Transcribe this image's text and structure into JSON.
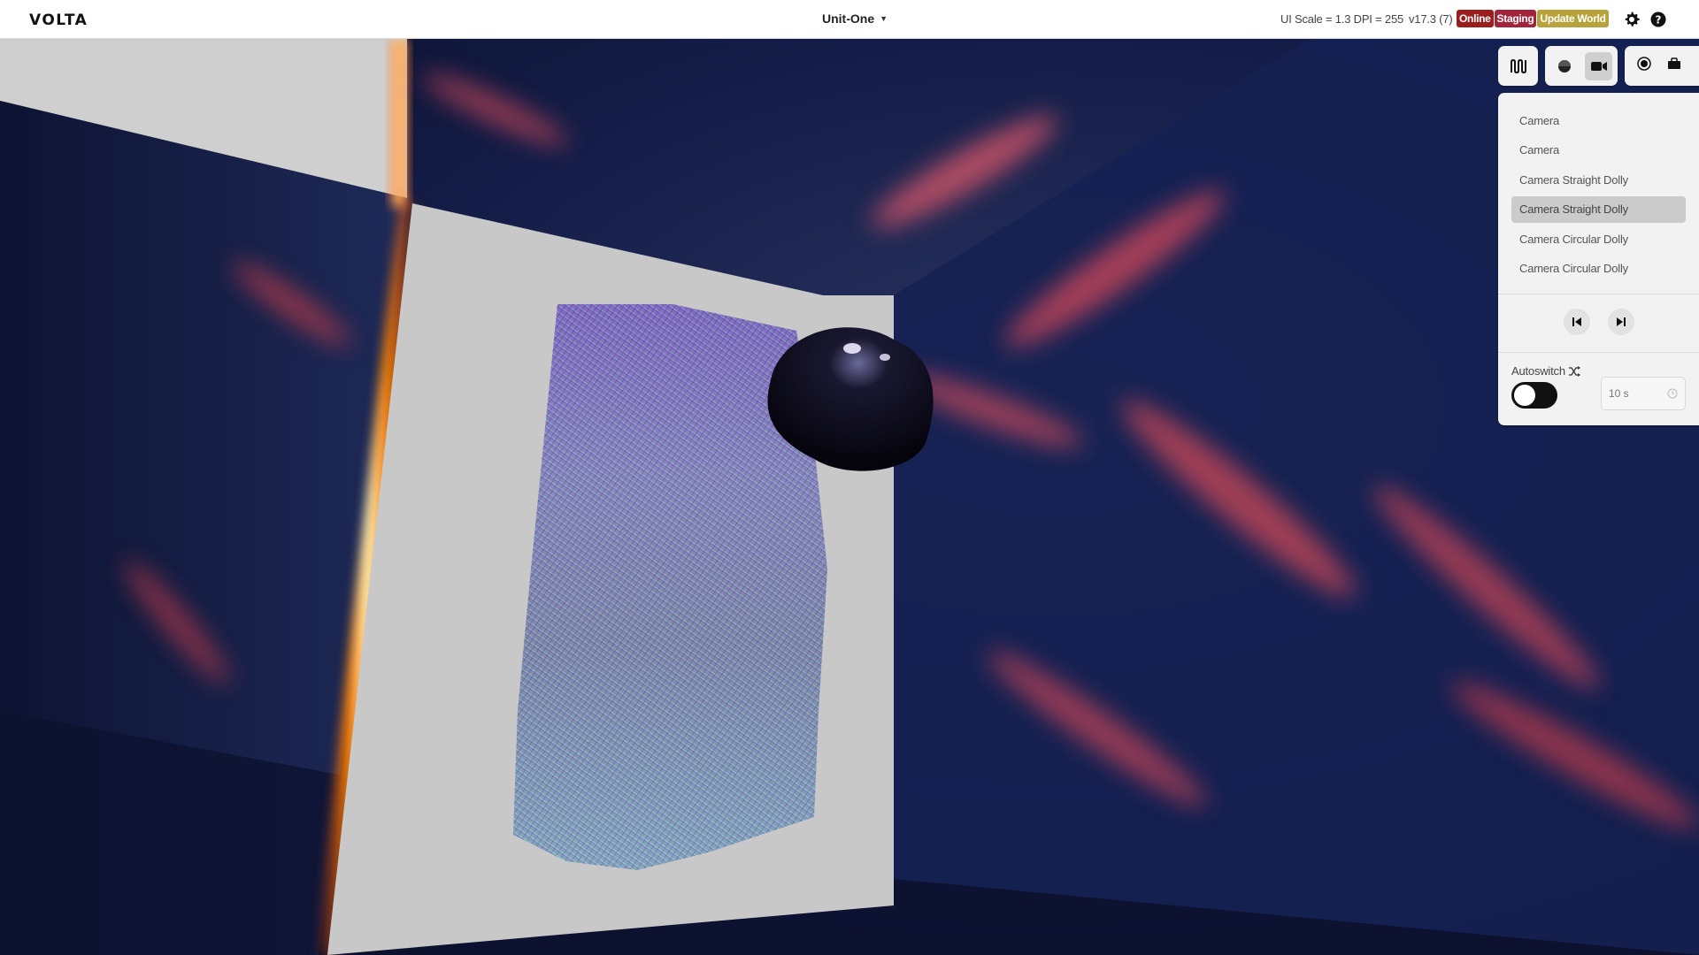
{
  "app": {
    "logo": "VOLTA",
    "project_name": "Unit-One",
    "ui_scale": "UI Scale = 1.3  DPI = 255",
    "version": "v17.3 (7)",
    "badges": {
      "online": "Online",
      "staging": "Staging",
      "update": "Update World"
    }
  },
  "colors": {
    "online_badge": "#9b1d1d",
    "staging_badge": "#a3233a",
    "update_badge": "#b8a23a",
    "panel_bg": "#f2f2f2",
    "selected_item": "#cbcbcb"
  },
  "toolbar": {
    "icons": [
      "sequencer-icon",
      "sphere-icon",
      "video-camera-icon",
      "record-icon",
      "briefcase-icon"
    ],
    "active": "video-camera-icon"
  },
  "camera_panel": {
    "items": [
      {
        "label": "Camera",
        "selected": false
      },
      {
        "label": "Camera",
        "selected": false
      },
      {
        "label": "Camera Straight Dolly",
        "selected": false
      },
      {
        "label": "Camera Straight Dolly",
        "selected": true
      },
      {
        "label": "Camera Circular Dolly",
        "selected": false
      },
      {
        "label": "Camera Circular Dolly",
        "selected": false
      }
    ],
    "autoswitch_label": "Autoswitch",
    "autoswitch_on": false,
    "interval_placeholder": "10 s"
  }
}
